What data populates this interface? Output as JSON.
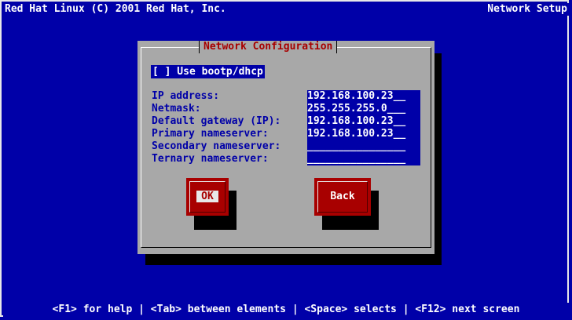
{
  "header": {
    "left_text": "Red Hat Linux (C) 2001 Red Hat, Inc.",
    "right_text": "Network Setup"
  },
  "dialog": {
    "title": "Network Configuration",
    "bootp_checkbox_label": "[ ] Use bootp/dhcp",
    "fields": [
      {
        "label": "IP address:",
        "value": "192.168.100.23__"
      },
      {
        "label": "Netmask:",
        "value": "255.255.255.0___"
      },
      {
        "label": "Default gateway (IP):",
        "value": "192.168.100.23__"
      },
      {
        "label": "Primary nameserver:",
        "value": "192.168.100.23__"
      },
      {
        "label": "Secondary nameserver:",
        "value": "________________"
      },
      {
        "label": "Ternary nameserver:",
        "value": "________________"
      }
    ],
    "ok_label": "OK",
    "back_label": "Back"
  },
  "footer": {
    "help_text": "<F1> for help | <Tab> between elements | <Space> selects | <F12> next screen"
  },
  "colors": {
    "background": "#0000a8",
    "dialog": "#a8a8a8",
    "button": "#a80000",
    "title_text": "#a80000"
  }
}
